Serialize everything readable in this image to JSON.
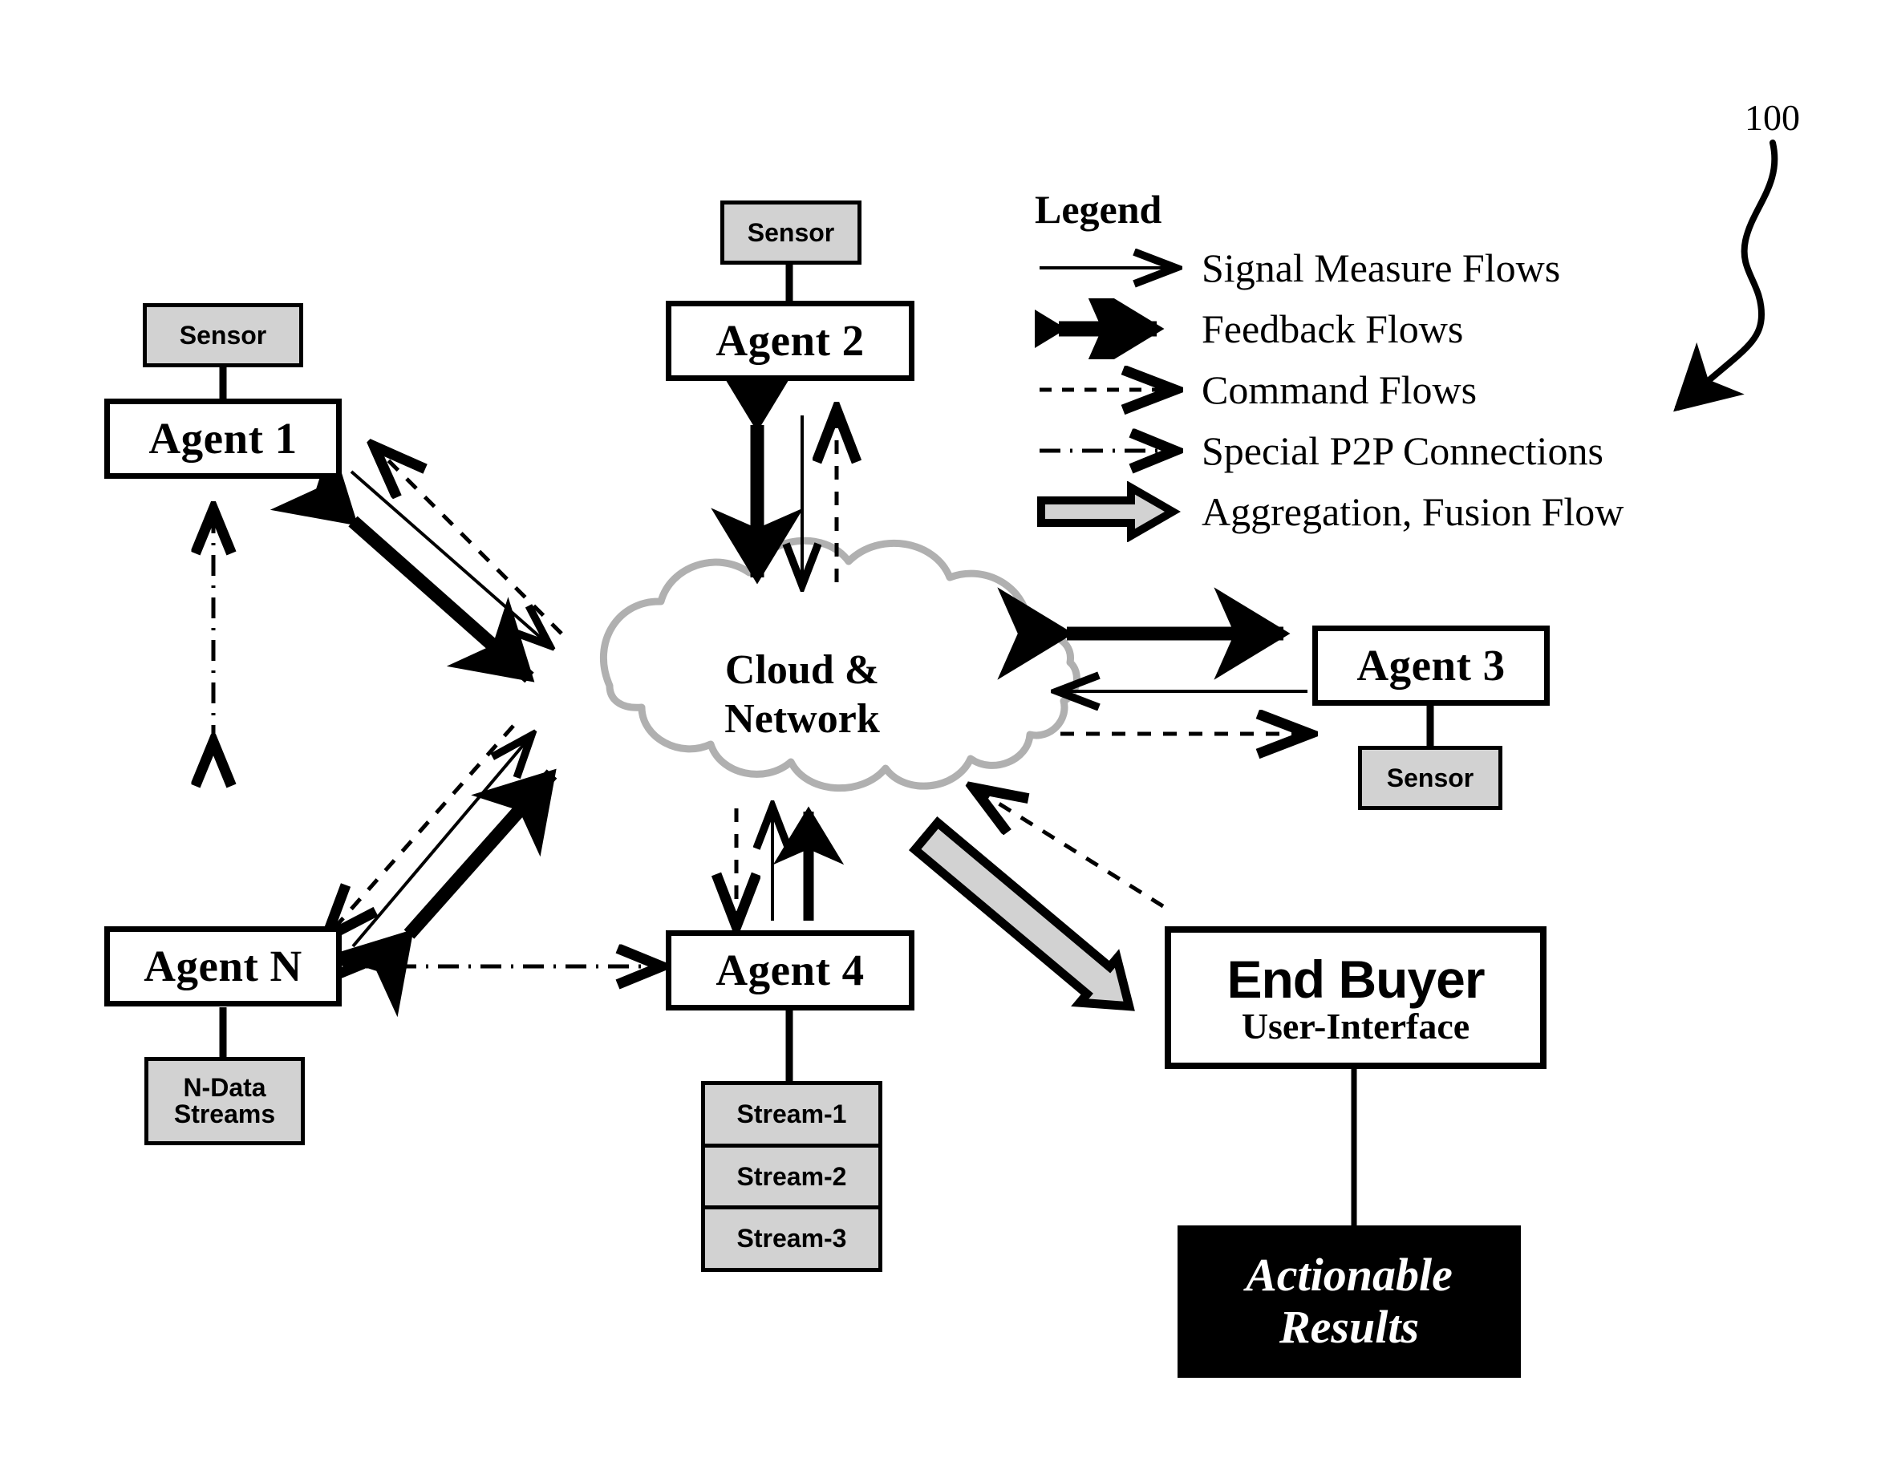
{
  "figure": {
    "reference_numeral": "100"
  },
  "legend": {
    "title": "Legend",
    "items": [
      {
        "glyph": "thin-arrow-right",
        "label": "Signal Measure Flows"
      },
      {
        "glyph": "bold-double-arrow",
        "label": "Feedback Flows"
      },
      {
        "glyph": "dashed-arrow-right",
        "label": "Command Flows"
      },
      {
        "glyph": "dashdot-arrow-right",
        "label": "Special P2P Connections"
      },
      {
        "glyph": "block-arrow-right",
        "label": "Aggregation, Fusion Flow"
      }
    ]
  },
  "nodes": {
    "agent1": {
      "label": "Agent 1"
    },
    "agent1_sensor": {
      "label": "Sensor"
    },
    "agent2": {
      "label": "Agent 2"
    },
    "agent2_sensor": {
      "label": "Sensor"
    },
    "agent3": {
      "label": "Agent 3"
    },
    "agent3_sensor": {
      "label": "Sensor"
    },
    "agent4": {
      "label": "Agent 4"
    },
    "agentN": {
      "label": "Agent N"
    },
    "agentN_data": {
      "line1": "N-Data",
      "line2": "Streams"
    },
    "cloud": {
      "line1": "Cloud &",
      "line2": "Network"
    },
    "streams": [
      {
        "label": "Stream-1"
      },
      {
        "label": "Stream-2"
      },
      {
        "label": "Stream-3"
      }
    ],
    "end_buyer": {
      "title": "End Buyer",
      "subtitle": "User-Interface"
    },
    "results": {
      "line1": "Actionable",
      "line2": "Results"
    }
  },
  "colors": {
    "ink": "#000000",
    "sensor_fill": "#d2d2d2",
    "cloud_stroke": "#b0b0b0",
    "fusion_fill": "#d2d2d2",
    "page": "#ffffff"
  },
  "connections": [
    {
      "from": "agent1_sensor",
      "to": "agent1",
      "style": "plain-line"
    },
    {
      "from": "agent2_sensor",
      "to": "agent2",
      "style": "plain-line"
    },
    {
      "from": "agent3",
      "to": "agent3_sensor",
      "style": "plain-line"
    },
    {
      "from": "agentN",
      "to": "agentN_data",
      "style": "plain-line"
    },
    {
      "from": "agent4",
      "to": "streams",
      "style": "plain-line"
    },
    {
      "from": "end_buyer",
      "to": "results",
      "style": "plain-line"
    },
    {
      "from": "agent2",
      "to": "cloud",
      "style": "bold-double-arrow"
    },
    {
      "from": "agent2",
      "to": "cloud",
      "style": "thin-arrow"
    },
    {
      "from": "cloud",
      "to": "agent2",
      "style": "dashed-arrow"
    },
    {
      "from": "agent1",
      "to": "cloud",
      "style": "bold-double-arrow"
    },
    {
      "from": "agent1",
      "to": "cloud",
      "style": "thin-arrow"
    },
    {
      "from": "cloud",
      "to": "agent1",
      "style": "dashed-arrow"
    },
    {
      "from": "agentN",
      "to": "cloud",
      "style": "bold-double-arrow"
    },
    {
      "from": "agentN",
      "to": "cloud",
      "style": "thin-arrow"
    },
    {
      "from": "cloud",
      "to": "agentN",
      "style": "dashed-arrow"
    },
    {
      "from": "agent1",
      "to": "agentN",
      "style": "dashdot-double-arrow"
    },
    {
      "from": "agentN",
      "to": "agent4",
      "style": "dashdot-double-arrow"
    },
    {
      "from": "agent4",
      "to": "cloud",
      "style": "thin-arrow"
    },
    {
      "from": "agent4",
      "to": "cloud",
      "style": "bold-arrow"
    },
    {
      "from": "cloud",
      "to": "agent4",
      "style": "dashed-arrow"
    },
    {
      "from": "cloud",
      "to": "agent3",
      "style": "bold-double-arrow"
    },
    {
      "from": "agent3",
      "to": "cloud",
      "style": "thin-arrow"
    },
    {
      "from": "cloud",
      "to": "agent3",
      "style": "dashed-arrow"
    },
    {
      "from": "cloud",
      "to": "end_buyer",
      "style": "block-arrow"
    },
    {
      "from": "end_buyer",
      "to": "cloud",
      "style": "dashed-arrow"
    }
  ]
}
